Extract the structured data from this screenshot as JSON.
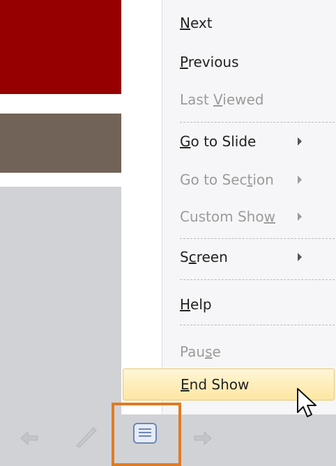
{
  "menu": {
    "items": [
      {
        "pre": "",
        "u": "N",
        "post": "ext",
        "disabled": false,
        "submenu": false
      },
      {
        "pre": "",
        "u": "P",
        "post": "revious",
        "disabled": false,
        "submenu": false
      },
      {
        "pre": "Last ",
        "u": "V",
        "post": "iewed",
        "disabled": true,
        "submenu": false
      },
      {
        "pre": "",
        "u": "G",
        "post": "o to Slide",
        "disabled": false,
        "submenu": true
      },
      {
        "pre": "Go to Sec",
        "u": "t",
        "post": "ion",
        "disabled": true,
        "submenu": true
      },
      {
        "pre": "Custom Sho",
        "u": "w",
        "post": "",
        "disabled": true,
        "submenu": true
      },
      {
        "pre": "S",
        "u": "c",
        "post": "reen",
        "disabled": false,
        "submenu": true
      },
      {
        "pre": "",
        "u": "H",
        "post": "elp",
        "disabled": false,
        "submenu": false
      },
      {
        "pre": "Pau",
        "u": "s",
        "post": "e",
        "disabled": true,
        "submenu": false
      },
      {
        "pre": "",
        "u": "E",
        "post": "nd Show",
        "disabled": false,
        "submenu": false,
        "highlighted": true
      }
    ]
  },
  "toolbar": {
    "icons": [
      "previous-arrow-icon",
      "pen-icon",
      "slide-menu-icon",
      "next-arrow-icon"
    ],
    "highlight_color": "#e07b22"
  },
  "colors": {
    "slide_red": "#960000",
    "slide_brown": "#726358",
    "menu_hover_bg": "#fde6a3"
  }
}
